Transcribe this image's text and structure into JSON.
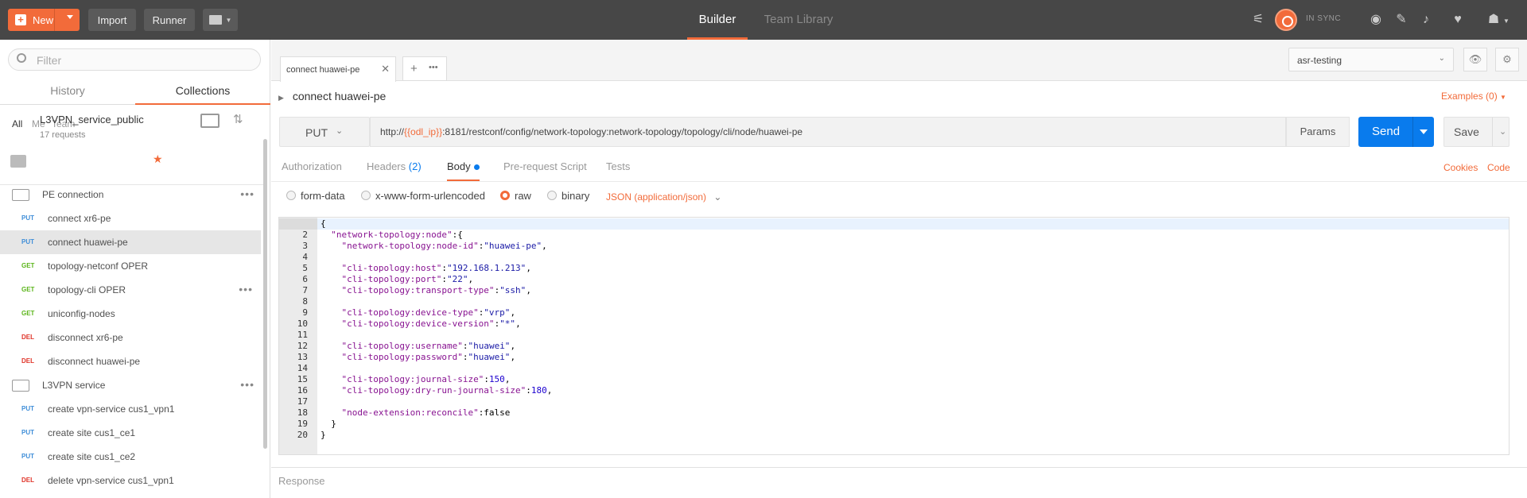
{
  "topbar": {
    "new_label": "New",
    "import_label": "Import",
    "runner_label": "Runner",
    "tab_builder": "Builder",
    "tab_team": "Team Library",
    "sync_status": "IN SYNC"
  },
  "sidebar": {
    "filter_placeholder": "Filter",
    "tab_history": "History",
    "tab_collections": "Collections",
    "filters": [
      "All",
      "Me",
      "Team"
    ],
    "collection": {
      "name": "L3VPN_service_public",
      "count": "17 requests"
    },
    "folders": [
      {
        "name": "PE connection",
        "items": [
          {
            "method": "PUT",
            "name": "connect xr6-pe"
          },
          {
            "method": "PUT",
            "name": "connect huawei-pe"
          },
          {
            "method": "GET",
            "name": "topology-netconf OPER"
          },
          {
            "method": "GET",
            "name": "topology-cli OPER"
          },
          {
            "method": "GET",
            "name": "uniconfig-nodes"
          },
          {
            "method": "DEL",
            "name": "disconnect xr6-pe"
          },
          {
            "method": "DEL",
            "name": "disconnect huawei-pe"
          }
        ]
      },
      {
        "name": "L3VPN service",
        "items": [
          {
            "method": "PUT",
            "name": "create vpn-service cus1_vpn1"
          },
          {
            "method": "PUT",
            "name": "create site cus1_ce1"
          },
          {
            "method": "PUT",
            "name": "create site cus1_ce2"
          },
          {
            "method": "DEL",
            "name": "delete vpn-service cus1_vpn1"
          }
        ]
      }
    ]
  },
  "main": {
    "open_tab": "connect huawei-pe",
    "environment": "asr-testing",
    "request_name": "connect huawei-pe",
    "examples": "Examples (0)",
    "method": "PUT",
    "url_prefix": "http://",
    "url_var": "{{odl_ip}}",
    "url_suffix": ":8181/restconf/config/network-topology:network-topology/topology/cli/node/huawei-pe",
    "params": "Params",
    "send": "Send",
    "save": "Save",
    "tabs": {
      "authorization": "Authorization",
      "headers": "Headers",
      "headers_count": "(2)",
      "body": "Body",
      "prerequest": "Pre-request Script",
      "tests": "Tests"
    },
    "cookies": "Cookies",
    "code": "Code",
    "body_types": {
      "form_data": "form-data",
      "urlencoded": "x-www-form-urlencoded",
      "raw": "raw",
      "binary": "binary",
      "json": "JSON (application/json)"
    },
    "response": "Response"
  },
  "code_lines": [
    "{",
    "  \"network-topology:node\":{",
    "    \"network-topology:node-id\":\"huawei-pe\",",
    "",
    "    \"cli-topology:host\":\"192.168.1.213\",",
    "    \"cli-topology:port\":\"22\",",
    "    \"cli-topology:transport-type\":\"ssh\",",
    "",
    "    \"cli-topology:device-type\":\"vrp\",",
    "    \"cli-topology:device-version\":\"*\",",
    "",
    "    \"cli-topology:username\":\"huawei\",",
    "    \"cli-topology:password\":\"huawei\",",
    "",
    "    \"cli-topology:journal-size\":150,",
    "    \"cli-topology:dry-run-journal-size\":180,",
    "",
    "    \"node-extension:reconcile\":false",
    "  }",
    "}"
  ]
}
